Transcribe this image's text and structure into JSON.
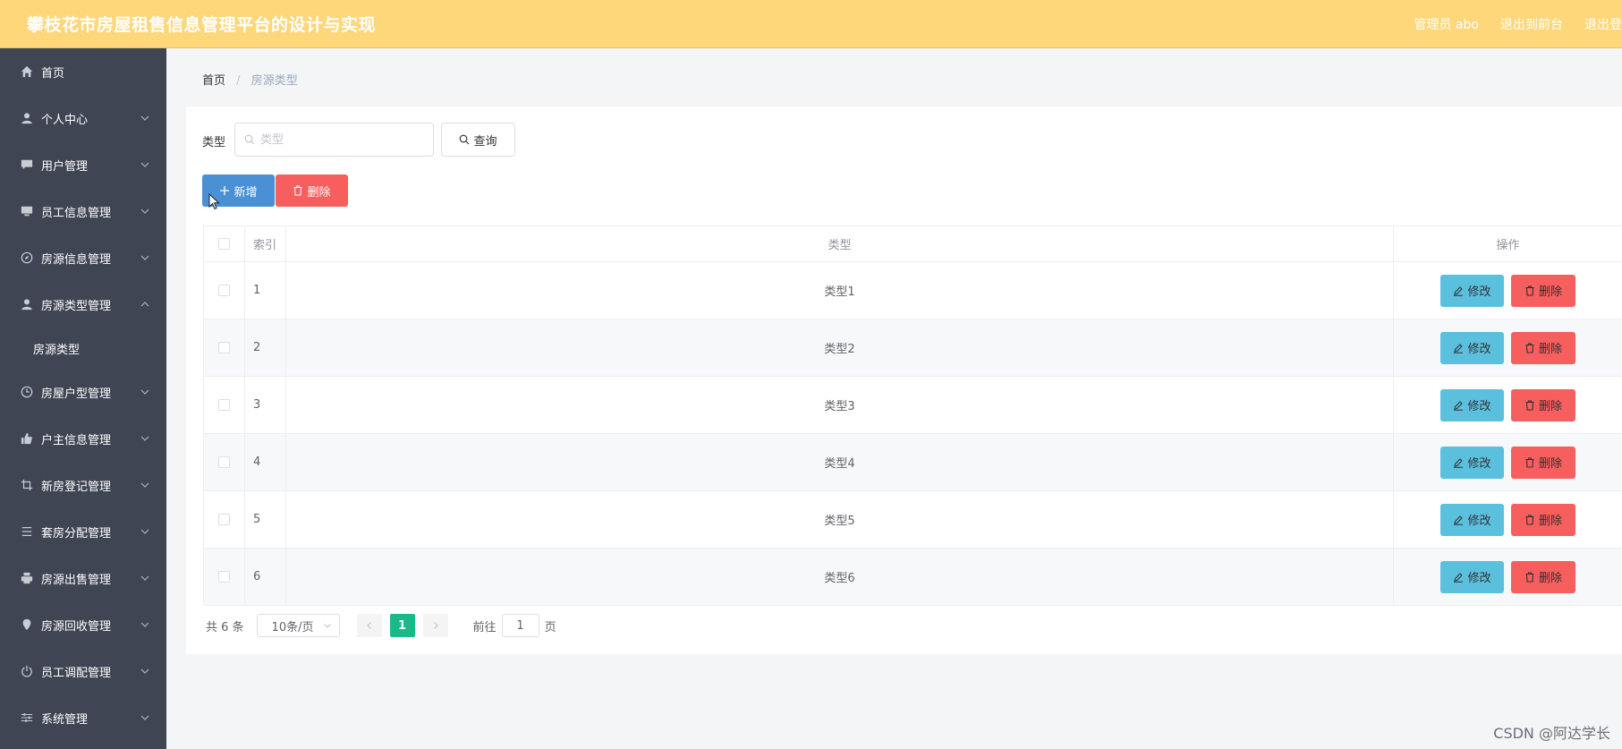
{
  "header": {
    "title": "攀枝花市房屋租售信息管理平台的设计与实现",
    "user": "管理员 abo",
    "exit_front": "退出到前台",
    "exit_login": "退出登"
  },
  "sidebar": {
    "items": [
      {
        "label": "首页",
        "icon": "home-icon"
      },
      {
        "label": "个人中心",
        "icon": "user-icon"
      },
      {
        "label": "用户管理",
        "icon": "comment-icon"
      },
      {
        "label": "员工信息管理",
        "icon": "monitor-icon"
      },
      {
        "label": "房源信息管理",
        "icon": "compass-icon"
      },
      {
        "label": "房源类型管理",
        "icon": "user-icon",
        "expanded": true
      },
      {
        "label": "房屋户型管理",
        "icon": "clock-icon"
      },
      {
        "label": "户主信息管理",
        "icon": "thumb-icon"
      },
      {
        "label": "新房登记管理",
        "icon": "crop-icon"
      },
      {
        "label": "套房分配管理",
        "icon": "list-icon"
      },
      {
        "label": "房源出售管理",
        "icon": "printer-icon"
      },
      {
        "label": "房源回收管理",
        "icon": "location-icon"
      },
      {
        "label": "员工调配管理",
        "icon": "power-icon"
      },
      {
        "label": "系统管理",
        "icon": "sliders-icon"
      }
    ],
    "sub_item": "房源类型"
  },
  "breadcrumb": {
    "home": "首页",
    "separator": "/",
    "current": "房源类型"
  },
  "search": {
    "label": "类型",
    "placeholder": "类型",
    "query_label": "查询"
  },
  "toolbar": {
    "add_label": "新增",
    "delete_label": "删除"
  },
  "table": {
    "columns": [
      "索引",
      "类型",
      "操作"
    ],
    "rows": [
      {
        "index": "1",
        "type": "类型1"
      },
      {
        "index": "2",
        "type": "类型2"
      },
      {
        "index": "3",
        "type": "类型3"
      },
      {
        "index": "4",
        "type": "类型4"
      },
      {
        "index": "5",
        "type": "类型5"
      },
      {
        "index": "6",
        "type": "类型6"
      }
    ],
    "edit_label": "修改",
    "delete_label": "删除"
  },
  "pagination": {
    "total": "共 6 条",
    "page_size": "10条/页",
    "current_page": "1",
    "goto_prefix": "前往",
    "goto_value": "1",
    "goto_suffix": "页"
  },
  "watermark": "CSDN @阿达学长",
  "colors": {
    "header": "#fdd77a",
    "sidebar": "#3f4553",
    "primary": "#4a90d4",
    "danger": "#f75e5e",
    "info": "#5bc0de",
    "page_active": "#19b989"
  }
}
